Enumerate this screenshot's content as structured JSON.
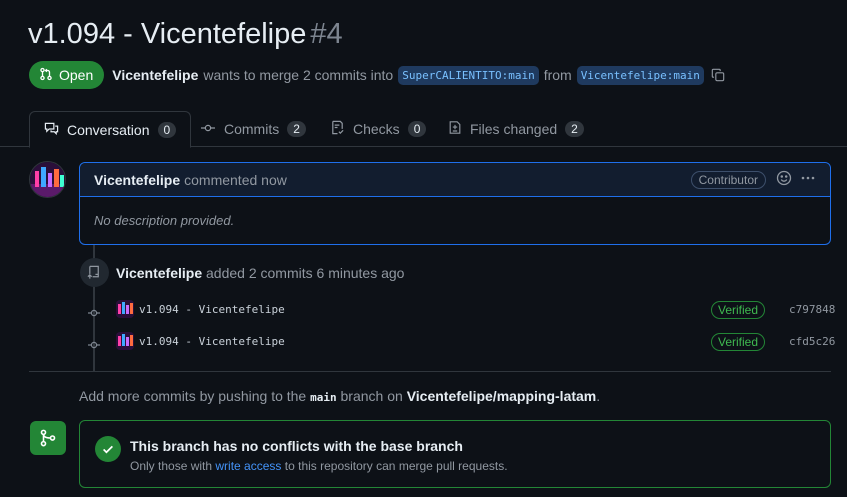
{
  "pr": {
    "title": "v1.094 - Vicentefelipe",
    "number": "#4",
    "state": "Open",
    "author": "Vicentefelipe",
    "merge_text": "wants to merge 2 commits into",
    "base_branch": "SuperCALIENTITO:main",
    "from_text": "from",
    "head_branch": "Vicentefelipe:main"
  },
  "tabs": [
    {
      "label": "Conversation",
      "count": "0"
    },
    {
      "label": "Commits",
      "count": "2"
    },
    {
      "label": "Checks",
      "count": "0"
    },
    {
      "label": "Files changed",
      "count": "2"
    }
  ],
  "comment": {
    "author": "Vicentefelipe",
    "action": "commented now",
    "badge": "Contributor",
    "body": "No description provided."
  },
  "event": {
    "author": "Vicentefelipe",
    "text": "added 2 commits 6 minutes ago"
  },
  "commits": [
    {
      "message": "v1.094 - Vicentefelipe",
      "verified": "Verified",
      "sha": "c797848"
    },
    {
      "message": "v1.094 - Vicentefelipe",
      "verified": "Verified",
      "sha": "cfd5c26"
    }
  ],
  "push_hint": {
    "prefix": "Add more commits by pushing to the",
    "branch": "main",
    "middle": "branch on",
    "repo": "Vicentefelipe/mapping-latam",
    "suffix": "."
  },
  "merge": {
    "title": "This branch has no conflicts with the base branch",
    "sub_prefix": "Only those with",
    "sub_link": "write access",
    "sub_suffix": "to this repository can merge pull requests."
  },
  "colors": {
    "accent_green": "#238636",
    "link_blue": "#4493f8",
    "bg": "#0d1117",
    "border": "#30363d"
  }
}
